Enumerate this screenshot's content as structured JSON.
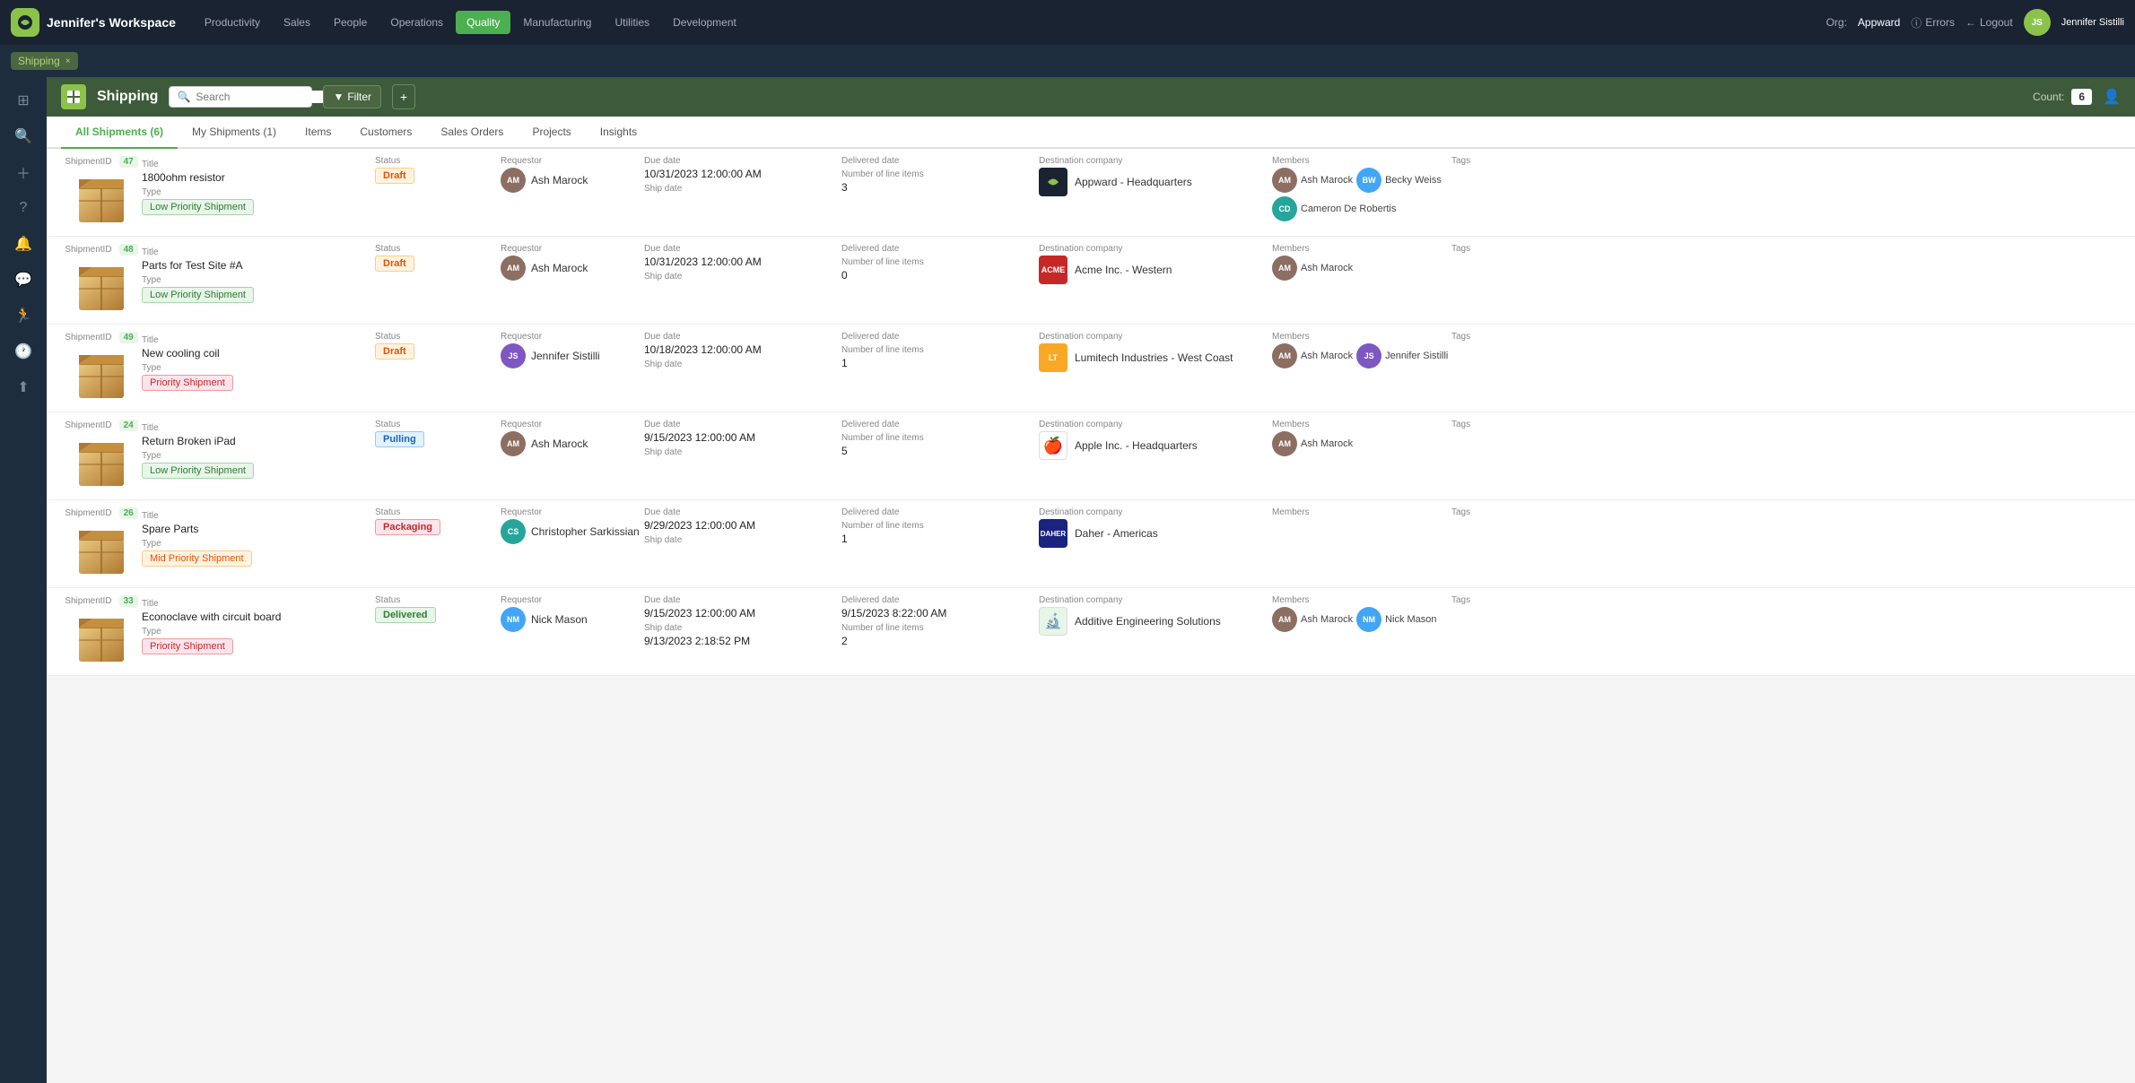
{
  "app": {
    "logo": "J",
    "workspace_title": "Jennifer's Workspace",
    "nav_items": [
      {
        "label": "Productivity",
        "active": false
      },
      {
        "label": "Sales",
        "active": false
      },
      {
        "label": "People",
        "active": false
      },
      {
        "label": "Operations",
        "active": false
      },
      {
        "label": "Quality",
        "active": true
      },
      {
        "label": "Manufacturing",
        "active": false
      },
      {
        "label": "Utilities",
        "active": false
      },
      {
        "label": "Development",
        "active": false
      }
    ],
    "org_label": "Org:",
    "org_name": "Appward",
    "errors_label": "Errors",
    "logout_label": "Logout",
    "user_name": "Jennifer Sistilli"
  },
  "tabs_bar": {
    "active_tab": "Shipping",
    "close_icon": "×"
  },
  "sidebar": {
    "icons": [
      "⊞",
      "🔍",
      "+",
      "?",
      "🔔",
      "💬",
      "🏃",
      "🕐",
      "⬆"
    ]
  },
  "module": {
    "title": "Shipping",
    "search_placeholder": "Search",
    "filter_label": "Filter",
    "add_icon": "+",
    "count_label": "Count:",
    "count_value": "6"
  },
  "sub_tabs": [
    {
      "label": "All Shipments (6)",
      "active": true
    },
    {
      "label": "My Shipments (1)",
      "active": false
    },
    {
      "label": "Items",
      "active": false
    },
    {
      "label": "Customers",
      "active": false
    },
    {
      "label": "Sales Orders",
      "active": false
    },
    {
      "label": "Projects",
      "active": false
    },
    {
      "label": "Insights",
      "active": false
    }
  ],
  "columns": {
    "shipment_id": "ShipmentID",
    "title": "Title",
    "status": "Status",
    "requestor": "Requestor",
    "due_date": "Due date",
    "delivered_date": "Delivered date",
    "destination": "Destination company",
    "members": "Members",
    "tags": "Tags",
    "ship_date": "Ship date",
    "line_items": "Number of line items",
    "type": "Type"
  },
  "shipments": [
    {
      "id": "47",
      "title": "1800ohm resistor",
      "status": "Draft",
      "status_type": "draft",
      "requestor_name": "Ash Marock",
      "requestor_initials": "AM",
      "requestor_color": "brown",
      "due_date": "10/31/2023 12:00:00 AM",
      "delivered_date": "",
      "ship_date": "",
      "line_items": "3",
      "destination": "Appward - Headquarters",
      "dest_type": "appward",
      "type": "Low Priority Shipment",
      "type_class": "type-low",
      "members": [
        {
          "name": "Ash Marock",
          "initials": "AM",
          "color": "brown"
        },
        {
          "name": "Becky Weiss",
          "initials": "BW",
          "color": "blue"
        },
        {
          "name": "Cameron De Robertis",
          "initials": "CD",
          "color": "teal"
        }
      ],
      "tags": ""
    },
    {
      "id": "48",
      "title": "Parts for Test Site #A",
      "status": "Draft",
      "status_type": "draft",
      "requestor_name": "Ash Marock",
      "requestor_initials": "AM",
      "requestor_color": "brown",
      "due_date": "10/31/2023 12:00:00 AM",
      "delivered_date": "",
      "ship_date": "",
      "line_items": "0",
      "destination": "Acme Inc. - Western",
      "dest_type": "acme",
      "type": "Low Priority Shipment",
      "type_class": "type-low",
      "members": [
        {
          "name": "Ash Marock",
          "initials": "AM",
          "color": "brown"
        }
      ],
      "tags": ""
    },
    {
      "id": "49",
      "title": "New cooling coil",
      "status": "Draft",
      "status_type": "draft",
      "requestor_name": "Jennifer Sistilli",
      "requestor_initials": "JS",
      "requestor_color": "purple",
      "due_date": "10/18/2023 12:00:00 AM",
      "delivered_date": "",
      "ship_date": "",
      "line_items": "1",
      "destination": "Lumitech Industries - West Coast",
      "dest_type": "lumitech",
      "type": "Priority Shipment",
      "type_class": "type-priority",
      "members": [
        {
          "name": "Ash Marock",
          "initials": "AM",
          "color": "brown"
        },
        {
          "name": "Jennifer Sistilli",
          "initials": "JS",
          "color": "purple"
        }
      ],
      "tags": ""
    },
    {
      "id": "24",
      "title": "Return Broken iPad",
      "status": "Pulling",
      "status_type": "pulling",
      "requestor_name": "Ash Marock",
      "requestor_initials": "AM",
      "requestor_color": "brown",
      "due_date": "9/15/2023 12:00:00 AM",
      "delivered_date": "",
      "ship_date": "",
      "line_items": "5",
      "destination": "Apple Inc. - Headquarters",
      "dest_type": "apple",
      "type": "Low Priority Shipment",
      "type_class": "type-low",
      "members": [
        {
          "name": "Ash Marock",
          "initials": "AM",
          "color": "brown"
        }
      ],
      "tags": ""
    },
    {
      "id": "26",
      "title": "Spare Parts",
      "status": "Packaging",
      "status_type": "packaging",
      "requestor_name": "Christopher Sarkissian",
      "requestor_initials": "CS",
      "requestor_color": "teal",
      "due_date": "9/29/2023 12:00:00 AM",
      "delivered_date": "",
      "ship_date": "",
      "line_items": "1",
      "destination": "Daher - Americas",
      "dest_type": "daher",
      "type": "Mid Priority Shipment",
      "type_class": "type-mid",
      "members": [],
      "tags": ""
    },
    {
      "id": "33",
      "title": "Econoclave with circuit board",
      "status": "Delivered",
      "status_type": "delivered",
      "requestor_name": "Nick Mason",
      "requestor_initials": "NM",
      "requestor_color": "blue",
      "due_date": "9/15/2023 12:00:00 AM",
      "delivered_date": "9/15/2023 8:22:00 AM",
      "ship_date": "9/13/2023 2:18:52 PM",
      "line_items": "2",
      "destination": "Additive Engineering Solutions",
      "dest_type": "aes",
      "type": "Priority Shipment",
      "type_class": "type-priority",
      "members": [
        {
          "name": "Ash Marock",
          "initials": "AM",
          "color": "brown"
        },
        {
          "name": "Nick Mason",
          "initials": "NM",
          "color": "blue"
        }
      ],
      "tags": ""
    }
  ]
}
